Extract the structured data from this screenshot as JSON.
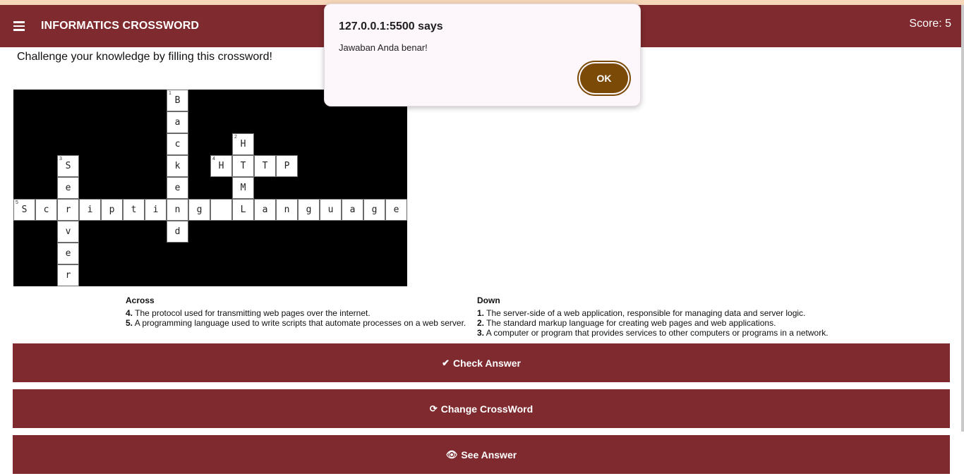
{
  "navbar": {
    "title": "INFORMATICS CROSSWORD",
    "score": "Score: 5"
  },
  "subtitle": "Challenge your knowledge by filling this crossword!",
  "grid": {
    "rows": 9,
    "cols": 18,
    "cells": [
      {
        "r": 0,
        "c": 7,
        "letter": "B",
        "num": "1"
      },
      {
        "r": 1,
        "c": 7,
        "letter": "a"
      },
      {
        "r": 2,
        "c": 7,
        "letter": "c"
      },
      {
        "r": 2,
        "c": 10,
        "letter": "H",
        "num": "2"
      },
      {
        "r": 3,
        "c": 2,
        "letter": "S",
        "num": "3"
      },
      {
        "r": 3,
        "c": 7,
        "letter": "k"
      },
      {
        "r": 3,
        "c": 9,
        "letter": "H",
        "num": "4"
      },
      {
        "r": 3,
        "c": 10,
        "letter": "T"
      },
      {
        "r": 3,
        "c": 11,
        "letter": "T"
      },
      {
        "r": 3,
        "c": 12,
        "letter": "P"
      },
      {
        "r": 4,
        "c": 2,
        "letter": "e"
      },
      {
        "r": 4,
        "c": 7,
        "letter": "e"
      },
      {
        "r": 4,
        "c": 10,
        "letter": "M"
      },
      {
        "r": 5,
        "c": 0,
        "letter": "S",
        "num": "5"
      },
      {
        "r": 5,
        "c": 1,
        "letter": "c"
      },
      {
        "r": 5,
        "c": 2,
        "letter": "r"
      },
      {
        "r": 5,
        "c": 3,
        "letter": "i"
      },
      {
        "r": 5,
        "c": 4,
        "letter": "p"
      },
      {
        "r": 5,
        "c": 5,
        "letter": "t"
      },
      {
        "r": 5,
        "c": 6,
        "letter": "i"
      },
      {
        "r": 5,
        "c": 7,
        "letter": "n"
      },
      {
        "r": 5,
        "c": 8,
        "letter": "g"
      },
      {
        "r": 5,
        "c": 9,
        "letter": ""
      },
      {
        "r": 5,
        "c": 10,
        "letter": "L"
      },
      {
        "r": 5,
        "c": 11,
        "letter": "a"
      },
      {
        "r": 5,
        "c": 12,
        "letter": "n"
      },
      {
        "r": 5,
        "c": 13,
        "letter": "g"
      },
      {
        "r": 5,
        "c": 14,
        "letter": "u"
      },
      {
        "r": 5,
        "c": 15,
        "letter": "a"
      },
      {
        "r": 5,
        "c": 16,
        "letter": "g"
      },
      {
        "r": 5,
        "c": 17,
        "letter": "e"
      },
      {
        "r": 6,
        "c": 2,
        "letter": "v"
      },
      {
        "r": 6,
        "c": 7,
        "letter": "d"
      },
      {
        "r": 7,
        "c": 2,
        "letter": "e"
      },
      {
        "r": 8,
        "c": 2,
        "letter": "r"
      }
    ]
  },
  "clues": {
    "across_title": "Across",
    "across": [
      {
        "num": "4.",
        "text": "The protocol used for transmitting web pages over the internet."
      },
      {
        "num": "5.",
        "text": "A programming language used to write scripts that automate processes on a web server."
      }
    ],
    "down_title": "Down",
    "down": [
      {
        "num": "1.",
        "text": "The server-side of a web application, responsible for managing data and server logic."
      },
      {
        "num": "2.",
        "text": "The standard markup language for creating web pages and web applications."
      },
      {
        "num": "3.",
        "text": "A computer or program that provides services to other computers or programs in a network."
      }
    ]
  },
  "buttons": {
    "check": "Check Answer",
    "change": "Change CrossWord",
    "see": "See Answer"
  },
  "icons": {
    "check": "check-icon",
    "change": "refresh-icon",
    "see": "eye-icon",
    "menu": "hamburger-menu-icon"
  },
  "dialog": {
    "title": "127.0.0.1:5500 says",
    "message": "Jawaban Anda benar!",
    "ok": "OK"
  },
  "colors": {
    "primary": "#7e2a2e",
    "dialog_button": "#7b4a07",
    "top_strip": "#f6d7b9"
  }
}
